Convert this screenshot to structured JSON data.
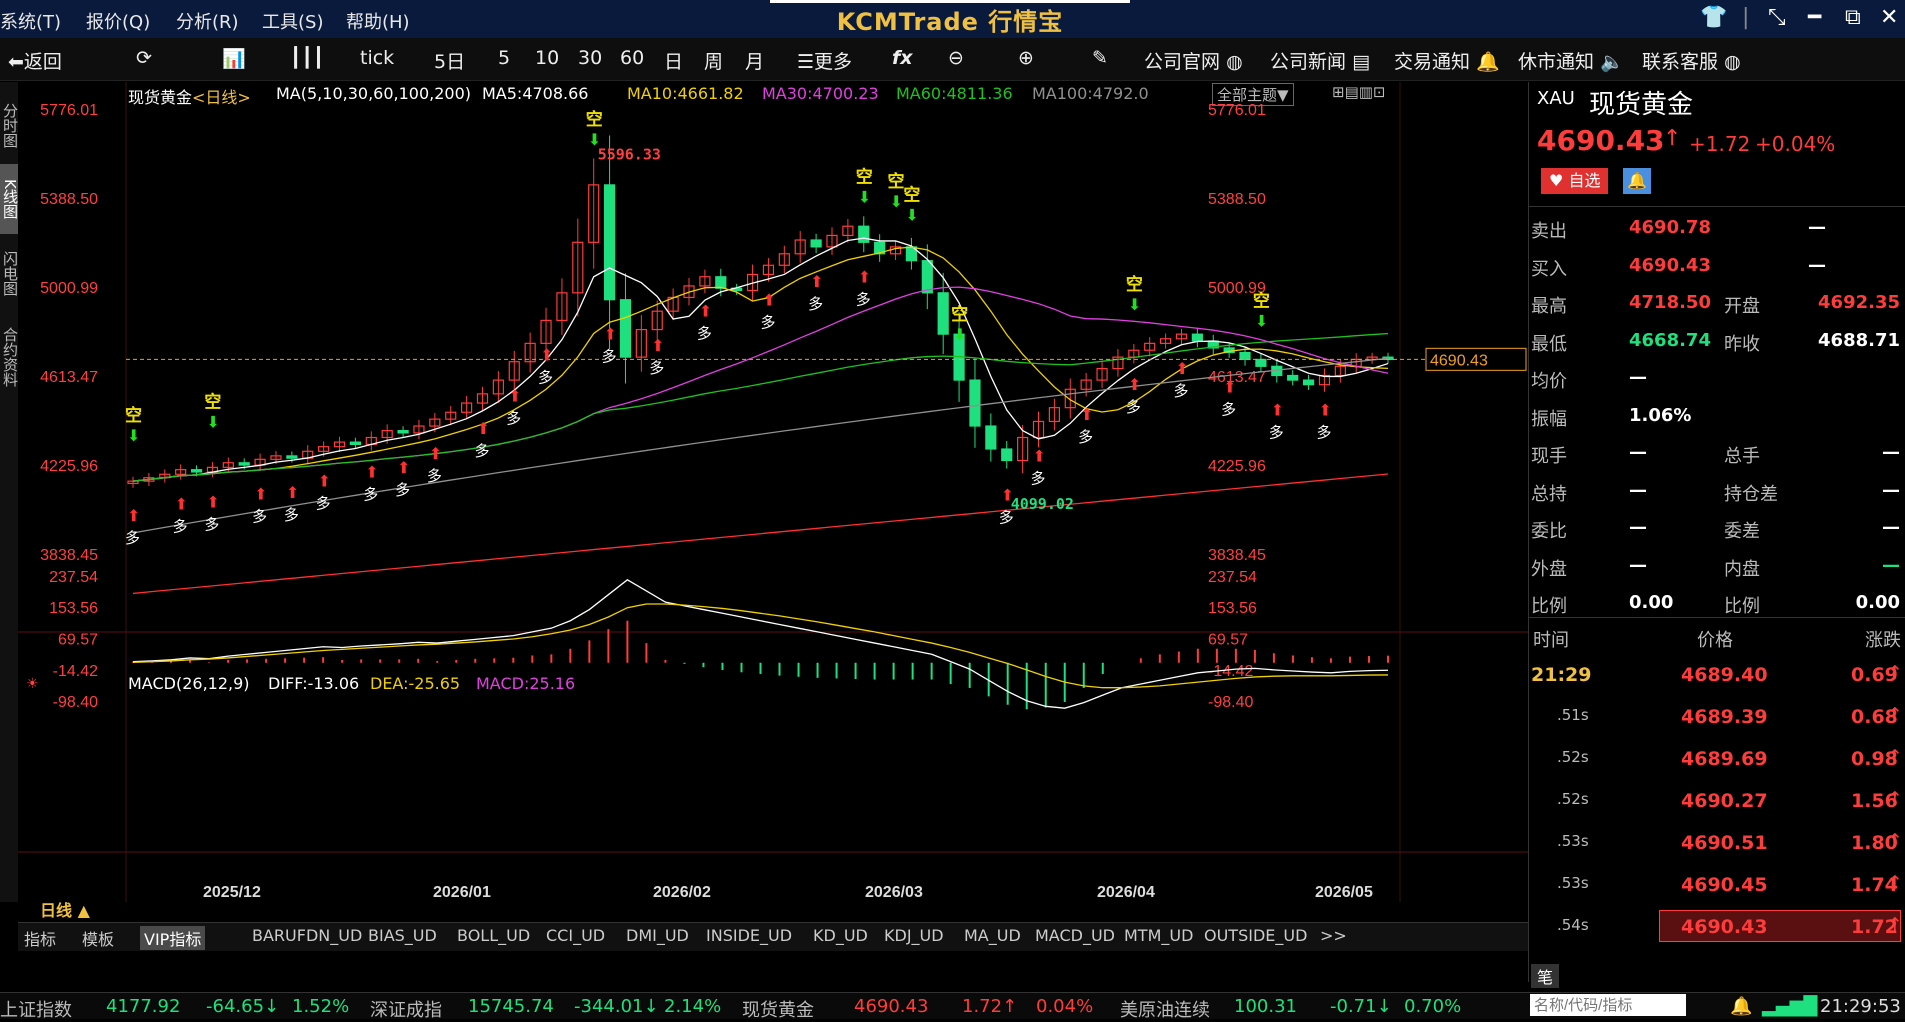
{
  "menubar": {
    "items": [
      "系统(T)",
      "报价(Q)",
      "分析(R)",
      "工具(S)",
      "帮助(H)"
    ],
    "brand": "KCMTrade 行情宝",
    "controls": [
      "shirt-icon",
      "minimize-corner-icon",
      "minimize-icon",
      "restore-icon",
      "close-icon"
    ]
  },
  "toolbar": {
    "back": "返回",
    "tick": "tick",
    "periods": [
      "5日",
      "5",
      "10",
      "30",
      "60",
      "日",
      "周",
      "月"
    ],
    "more": "更多",
    "fx": "fx",
    "links": [
      "公司官网",
      "公司新闻",
      "交易通知",
      "休市通知",
      "联系客服"
    ]
  },
  "lefttabs": [
    "分时图",
    "K线图",
    "闪电图",
    "合约资料"
  ],
  "chart_header": {
    "symbol": "现货黄金",
    "period": "<日线>",
    "ma_params": "MA(5,10,30,60,100,200)",
    "ma5": "MA5:4708.66",
    "ma10": "MA10:4661.82",
    "ma30": "MA30:4700.23",
    "ma60": "MA60:4811.36",
    "ma100": "MA100:4792.0",
    "theme_btn": "全部主题▼",
    "macd_label": "MACD(26,12,9)",
    "diff": "DIFF:-13.06",
    "dea": "DEA:-25.65",
    "macd": "MACD:25.16",
    "period_label": "日线 ▲"
  },
  "chart_data": {
    "type": "candlestick",
    "symbol": "现货黄金",
    "y_ticks": [
      "5776.01",
      "5388.50",
      "5000.99",
      "4613.47",
      "4225.96",
      "3838.45"
    ],
    "ylim": [
      3838.45,
      5776.01
    ],
    "x_labels": [
      "2025/12",
      "2026/01",
      "2026/02",
      "2026/03",
      "2026/04",
      "2026/05"
    ],
    "current_price_label": "4690.43",
    "high_annotation": "5596.33",
    "low_annotation": "4099.02",
    "signal_long": "多",
    "signal_short": "空",
    "close_series": [
      4160,
      4175,
      4190,
      4210,
      4200,
      4220,
      4240,
      4230,
      4255,
      4270,
      4260,
      4290,
      4310,
      4330,
      4320,
      4350,
      4380,
      4370,
      4400,
      4430,
      4460,
      4500,
      4540,
      4600,
      4680,
      4760,
      4860,
      4980,
      5200,
      5450,
      4950,
      4700,
      4820,
      4900,
      4960,
      5010,
      5050,
      5000,
      4990,
      5060,
      5100,
      5150,
      5210,
      5180,
      5230,
      5270,
      5200,
      5150,
      5180,
      5120,
      4980,
      4800,
      4600,
      4400,
      4300,
      4250,
      4350,
      4420,
      4480,
      4560,
      4600,
      4650,
      4700,
      4730,
      4760,
      4780,
      4800,
      4770,
      4740,
      4720,
      4690,
      4660,
      4620,
      4600,
      4580,
      4620,
      4660,
      4690,
      4700,
      4690
    ],
    "ma_series": [
      "MA5",
      "MA10",
      "MA30",
      "MA60",
      "MA100",
      "MA200"
    ],
    "macd_ticks": [
      "237.54",
      "153.56",
      "69.57",
      "-14.42",
      "-98.40"
    ],
    "macd_ylim": [
      -140,
      237.54
    ],
    "diff_series": [
      10,
      12,
      15,
      20,
      18,
      25,
      30,
      35,
      40,
      45,
      50,
      48,
      52,
      55,
      58,
      62,
      60,
      65,
      70,
      75,
      80,
      90,
      100,
      120,
      150,
      190,
      230,
      200,
      170,
      160,
      150,
      140,
      130,
      120,
      110,
      100,
      90,
      80,
      70,
      60,
      50,
      40,
      30,
      10,
      -10,
      -40,
      -70,
      -95,
      -110,
      -115,
      -100,
      -80,
      -60,
      -50,
      -40,
      -30,
      -20,
      -15,
      -10,
      -8,
      -12,
      -15,
      -18,
      -20,
      -16,
      -14,
      -13
    ],
    "dea_series": [
      8,
      10,
      12,
      15,
      17,
      20,
      24,
      28,
      32,
      36,
      40,
      43,
      46,
      49,
      52,
      55,
      57,
      60,
      63,
      67,
      71,
      77,
      85,
      95,
      110,
      130,
      155,
      165,
      165,
      162,
      158,
      153,
      147,
      140,
      133,
      125,
      117,
      108,
      99,
      90,
      80,
      70,
      60,
      48,
      35,
      20,
      5,
      -12,
      -30,
      -45,
      -55,
      -60,
      -60,
      -58,
      -55,
      -50,
      -45,
      -40,
      -35,
      -31,
      -29,
      -28,
      -28,
      -28,
      -27,
      -26,
      -25.65
    ]
  },
  "quote": {
    "code": "XAU",
    "name": "现货黄金",
    "price": "4690.43",
    "change": "+1.72",
    "change_pct": "+0.04%",
    "fav_btn": "自选",
    "rows": [
      {
        "l1": "卖出",
        "v1": "4690.78",
        "l2": "",
        "v2": "—"
      },
      {
        "l1": "买入",
        "v1": "4690.43",
        "l2": "",
        "v2": "—"
      },
      {
        "l1": "最高",
        "v1": "4718.50",
        "l2": "开盘",
        "v2": "4692.35"
      },
      {
        "l1": "最低",
        "v1": "4668.74",
        "l2": "昨收",
        "v2": "4688.71"
      },
      {
        "l1": "均价",
        "v1": "—",
        "l2": "",
        "v2": ""
      },
      {
        "l1": "振幅",
        "v1": "1.06%",
        "l2": "",
        "v2": ""
      },
      {
        "l1": "现手",
        "v1": "—",
        "l2": "总手",
        "v2": "—"
      },
      {
        "l1": "总持",
        "v1": "—",
        "l2": "持仓差",
        "v2": "—"
      },
      {
        "l1": "委比",
        "v1": "—",
        "l2": "委差",
        "v2": "—"
      },
      {
        "l1": "外盘",
        "v1": "—",
        "l2": "内盘",
        "v2": "—"
      },
      {
        "l1": "比例",
        "v1": "0.00",
        "l2": "比例",
        "v2": "0.00"
      }
    ],
    "tick_headers": [
      "时间",
      "价格",
      "涨跌"
    ],
    "ticks": [
      {
        "t": "21:29",
        "p": "4689.40",
        "c": "0.69"
      },
      {
        "t": ".51s",
        "p": "4689.39",
        "c": "0.68"
      },
      {
        "t": ".52s",
        "p": "4689.69",
        "c": "0.98"
      },
      {
        "t": ".52s",
        "p": "4690.27",
        "c": "1.56"
      },
      {
        "t": ".53s",
        "p": "4690.51",
        "c": "1.80"
      },
      {
        "t": ".53s",
        "p": "4690.45",
        "c": "1.74"
      },
      {
        "t": ".54s",
        "p": "4690.43",
        "c": "1.72"
      }
    ],
    "bottom_tab": "笔",
    "search_placeholder": "名称/代码/指标"
  },
  "bottomtabs": [
    "指标",
    "模板",
    "VIP指标",
    "BARUFDN_UD",
    "BIAS_UD",
    "BOLL_UD",
    "CCI_UD",
    "DMI_UD",
    "INSIDE_UD",
    "KD_UD",
    "KDJ_UD",
    "MA_UD",
    "MACD_UD",
    "MTM_UD",
    "OUTSIDE_UD",
    ">>"
  ],
  "statusbar": [
    {
      "name": "上证指数",
      "price": "4177.92",
      "chg": "-64.65↓",
      "pct": "1.52%"
    },
    {
      "name": "深证成指",
      "price": "15745.74",
      "chg": "-344.01↓",
      "pct": "2.14%"
    },
    {
      "name": "现货黄金",
      "price": "4690.43",
      "chg": "1.72↑",
      "pct": "0.04%"
    },
    {
      "name": "美原油连续",
      "price": "100.31",
      "chg": "-0.71↓",
      "pct": "0.70%"
    }
  ],
  "clock": "21:29:53",
  "colors": {
    "up": "#ff3c3c",
    "down": "#1ee07e",
    "ma5": "#ffffff",
    "ma10": "#f0d000",
    "ma30": "#e040e0",
    "ma60": "#20c020",
    "ma100": "#909090",
    "ma200": "#ff3030"
  }
}
